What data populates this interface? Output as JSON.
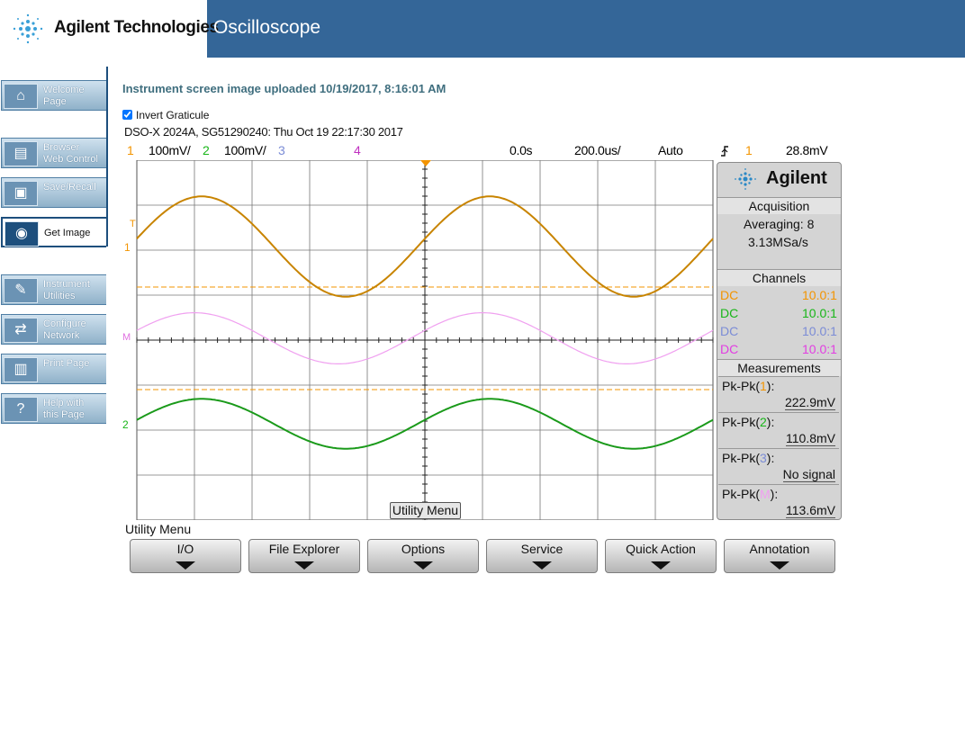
{
  "header": {
    "brand": "Agilent Technologies",
    "title": "Oscilloscope",
    "bar_color": "#346698"
  },
  "sidebar": {
    "items": [
      {
        "label": "Welcome\nPage",
        "icon": "home-icon"
      },
      {
        "label": "Browser\nWeb Control",
        "icon": "scope-icon"
      },
      {
        "label": "Save/Recall",
        "icon": "disk-icon"
      },
      {
        "label": "Get Image",
        "icon": "camera-icon",
        "active": true
      },
      {
        "label": "Instrument\nUtilities",
        "icon": "wrench-icon"
      },
      {
        "label": "Configure\nNetwork",
        "icon": "network-icon"
      },
      {
        "label": "Print Page",
        "icon": "printer-icon"
      },
      {
        "label": "Help with\nthis Page",
        "icon": "help-icon"
      }
    ]
  },
  "main": {
    "upload_msg": "Instrument screen image uploaded  10/19/2017, 8:16:01 AM",
    "invert_label": "Invert Graticule",
    "invert_checked": true
  },
  "scope": {
    "model_line": "DSO-X 2024A, SG51290240: Thu Oct 19 22:17:30 2017",
    "status": {
      "ch1_num": "1",
      "ch1_scale": "100mV/",
      "ch2_num": "2",
      "ch2_scale": "100mV/",
      "ch3_num": "3",
      "ch4_num": "4",
      "delay": "0.0s",
      "timebase": "200.0us/",
      "mode": "Auto",
      "trig_icon": "trigger-edge-icon",
      "trig_src": "1",
      "trig_level": "28.8mV"
    },
    "colors": {
      "ch1": "#f39400",
      "ch2": "#18b618",
      "ch3": "#7b8cd6",
      "ch4": "#e23ee2",
      "math": "#f0a0f0",
      "ch1_trace": "#c88400",
      "ch2_trace": "#1a9a1a"
    },
    "markers": {
      "trig": "T",
      "ch1": "1",
      "math": "M",
      "ch2": "2"
    },
    "utility_button": "Utility Menu",
    "panel": {
      "brand": "Agilent",
      "acquisition": {
        "title": "Acquisition",
        "mode": "Averaging: 8",
        "rate": "3.13MSa/s"
      },
      "channels": {
        "title": "Channels",
        "rows": [
          {
            "coupling": "DC",
            "probe": "10.0:1"
          },
          {
            "coupling": "DC",
            "probe": "10.0:1"
          },
          {
            "coupling": "DC",
            "probe": "10.0:1"
          },
          {
            "coupling": "DC",
            "probe": "10.0:1"
          }
        ]
      },
      "measurements": {
        "title": "Measurements",
        "items": [
          {
            "label_pre": "Pk-Pk(",
            "src": "1",
            "label_post": "):",
            "value": "222.9mV"
          },
          {
            "label_pre": "Pk-Pk(",
            "src": "2",
            "label_post": "):",
            "value": "110.8mV"
          },
          {
            "label_pre": "Pk-Pk(",
            "src": "3",
            "label_post": "):",
            "value": "No signal"
          },
          {
            "label_pre": "Pk-Pk(",
            "src": "M",
            "label_post": "):",
            "value": "113.6mV"
          }
        ]
      }
    },
    "softkeys": {
      "menu_label": "Utility Menu",
      "keys": [
        "I/O",
        "File Explorer",
        "Options",
        "Service",
        "Quick Action",
        "Annotation"
      ]
    }
  }
}
